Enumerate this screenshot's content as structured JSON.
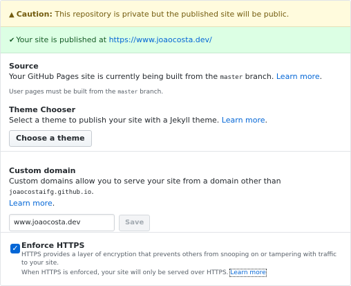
{
  "caution": {
    "icon": "warning-icon",
    "label": "Caution:",
    "message": " This repository is private but the published site will be public."
  },
  "published": {
    "icon": "check-icon",
    "text": "Your site is published at ",
    "url": "https://www.joaocosta.dev/"
  },
  "source": {
    "title": "Source",
    "desc_before": "Your GitHub Pages site is currently being built from the ",
    "branch": "master",
    "desc_after": " branch. ",
    "learn_more": "Learn more",
    "learn_more_suffix": ".",
    "note_before": "User pages must be built from the ",
    "note_branch": "master",
    "note_after": " branch."
  },
  "theme": {
    "title": "Theme Chooser",
    "desc": "Select a theme to publish your site with a Jekyll theme. ",
    "learn_more": "Learn more",
    "learn_more_suffix": ".",
    "button": "Choose a theme"
  },
  "domain": {
    "title": "Custom domain",
    "desc": "Custom domains allow you to serve your site from a domain other than ",
    "default_domain": "joaocostaifg.github.io",
    "default_suffix": ".",
    "learn_more": "Learn more",
    "learn_more_suffix": ".",
    "input_value": "www.joaocosta.dev",
    "save": "Save"
  },
  "https": {
    "checked": true,
    "title": "Enforce HTTPS",
    "desc": "HTTPS provides a layer of encryption that prevents others from snooping on or tampering with traffic to your site.",
    "desc2": "When HTTPS is enforced, your site will only be served over HTTPS. ",
    "learn_more": "Learn more"
  },
  "colors": {
    "link": "#0366d6",
    "warn_bg": "#fffbdd",
    "success_bg": "#dcffe4",
    "checkbox": "#0366d6"
  }
}
